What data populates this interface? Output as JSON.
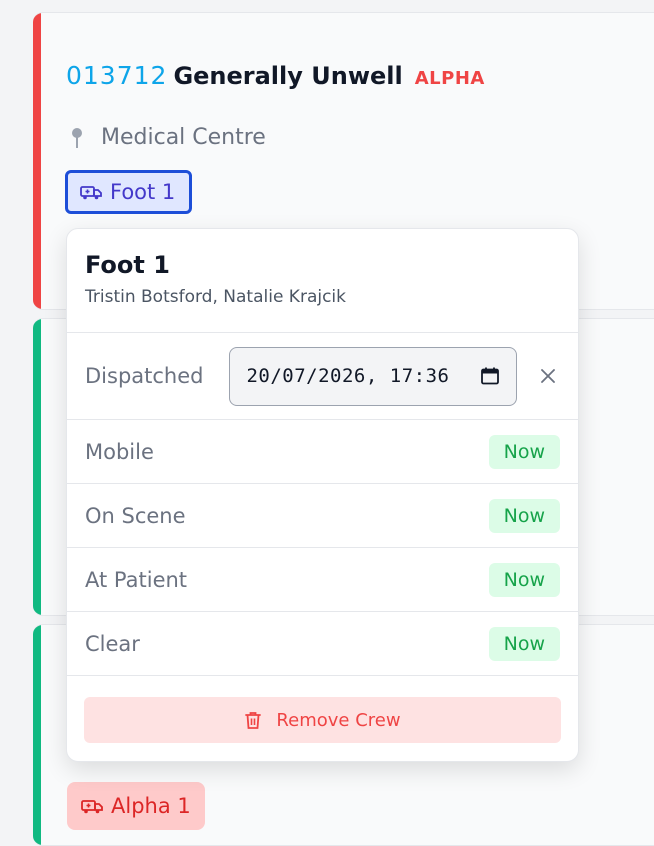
{
  "incident": {
    "number": "013712",
    "name": "Generally Unwell",
    "level": "ALPHA",
    "location": "Medical Centre"
  },
  "crew_chip": {
    "label": "Foot 1",
    "icon": "ambulance-icon"
  },
  "crew_chip_below": {
    "label": "Alpha 1",
    "icon": "ambulance-icon"
  },
  "popover": {
    "title": "Foot 1",
    "members": "Tristin Botsford, Natalie Krajcik",
    "dispatched": {
      "label": "Dispatched",
      "value": "20/07/2026, 17:36"
    },
    "statuses": [
      {
        "label": "Mobile",
        "action": "Now"
      },
      {
        "label": "On Scene",
        "action": "Now"
      },
      {
        "label": "At Patient",
        "action": "Now"
      },
      {
        "label": "Clear",
        "action": "Now"
      }
    ],
    "remove_label": "Remove Crew"
  },
  "colors": {
    "accent_red": "#ef4444",
    "accent_green": "#10b981",
    "link_blue": "#0ea5e9",
    "chip_border": "#1d4ed8",
    "now_green": "#16a34a"
  }
}
